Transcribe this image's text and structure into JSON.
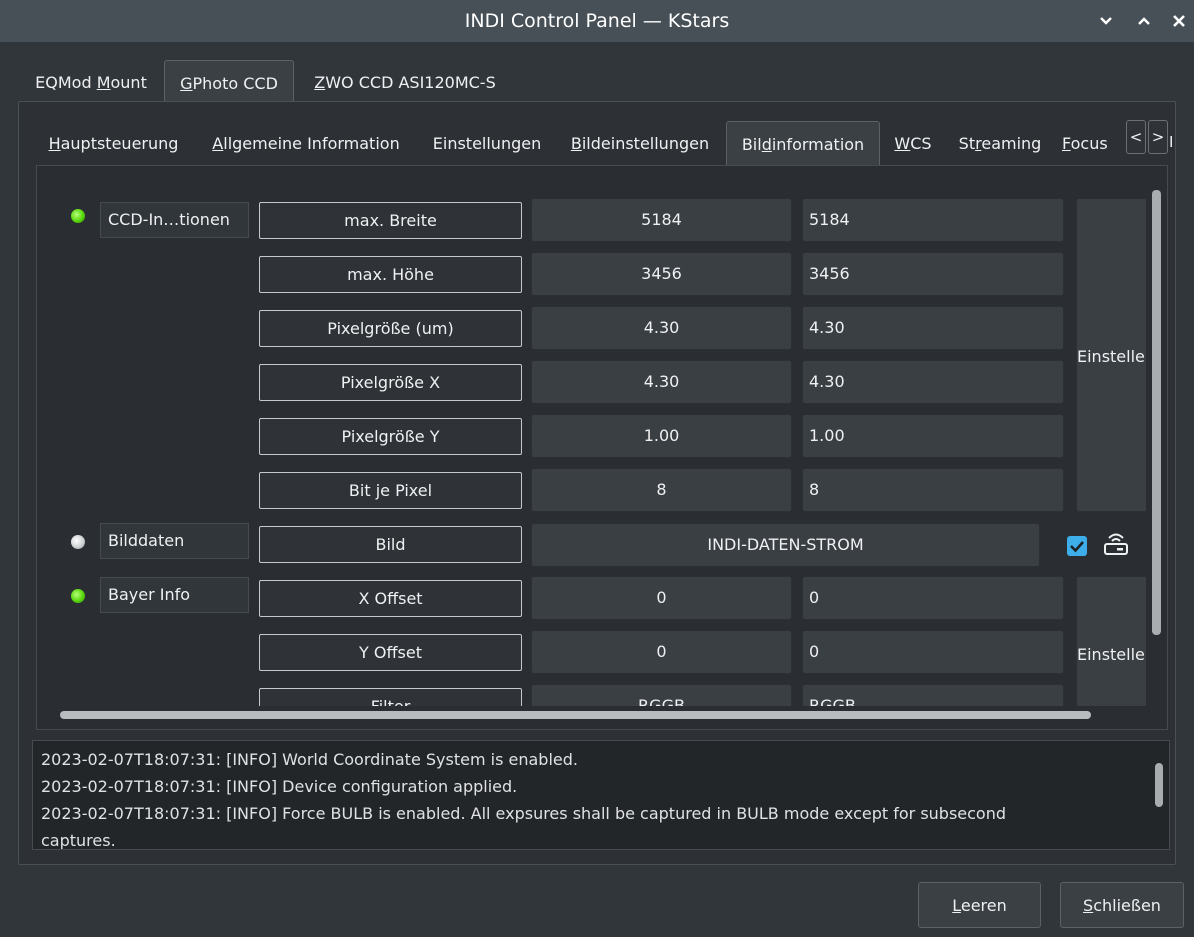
{
  "window": {
    "title": "INDI Control Panel — KStars",
    "min_icon": "chevron-down",
    "max_icon": "chevron-up",
    "close_icon": "x"
  },
  "device_tabs": [
    {
      "pre": "EQMod ",
      "ul": "M",
      "post": "ount"
    },
    {
      "pre": "",
      "ul": "G",
      "post": "Photo CCD"
    },
    {
      "pre": "",
      "ul": "Z",
      "post": "WO CCD ASI120MC-S"
    }
  ],
  "inner_tabs": [
    {
      "pre": "",
      "ul": "H",
      "post": "auptsteuerung"
    },
    {
      "pre": "",
      "ul": "A",
      "post": "llgemeine Information"
    },
    {
      "pre": "Einstellungen",
      "ul": "",
      "post": ""
    },
    {
      "pre": "",
      "ul": "B",
      "post": "ildeinstellungen"
    },
    {
      "pre": "Bil",
      "ul": "d",
      "post": "information"
    },
    {
      "pre": "",
      "ul": "W",
      "post": "CS"
    },
    {
      "pre": "St",
      "ul": "r",
      "post": "eaming"
    },
    {
      "pre": "",
      "ul": "F",
      "post": "ocus"
    }
  ],
  "tab_scroll": {
    "left": "<",
    "right": ">",
    "overflow": "I"
  },
  "groups": {
    "ccd": {
      "label": "CCD-In…tionen",
      "rows": [
        {
          "name": "max. Breite",
          "value": "5184",
          "input": "5184"
        },
        {
          "name": "max. Höhe",
          "value": "3456",
          "input": "3456"
        },
        {
          "name": "Pixelgröße (um)",
          "value": "4.30",
          "input": "4.30"
        },
        {
          "name": "Pixelgröße X",
          "value": "4.30",
          "input": "4.30"
        },
        {
          "name": "Pixelgröße Y",
          "value": "1.00",
          "input": "1.00"
        },
        {
          "name": "Bit je Pixel",
          "value": "8",
          "input": "8"
        }
      ],
      "set_label": "Einstellen"
    },
    "blob": {
      "label": "Bilddaten",
      "name": "Bild",
      "value": "INDI-DATEN-STROM",
      "checked": true
    },
    "bayer": {
      "label": "Bayer Info",
      "rows": [
        {
          "name": "X Offset",
          "value": "0",
          "input": "0"
        },
        {
          "name": "Y Offset",
          "value": "0",
          "input": "0"
        },
        {
          "name": "Filter",
          "value": "RGGB",
          "input": "RGGB"
        }
      ],
      "set_label": "Einstellen"
    }
  },
  "log": [
    "2023-02-07T18:07:31: [INFO] World Coordinate System is enabled.",
    "2023-02-07T18:07:31: [INFO] Device configuration applied.",
    "2023-02-07T18:07:31: [INFO] Force BULB is enabled. All expsures shall be captured in BULB mode except for subsecond",
    "captures."
  ],
  "buttons": {
    "clear": {
      "pre": "",
      "ul": "L",
      "post": "eeren"
    },
    "close": {
      "pre": "",
      "ul": "S",
      "post": "chließen"
    }
  },
  "colors": {
    "background": "#31363b",
    "titlebar": "#475057",
    "led_ok": "#57d40a",
    "led_idle": "#cfd2d4",
    "checkbox": "#3daee9"
  }
}
